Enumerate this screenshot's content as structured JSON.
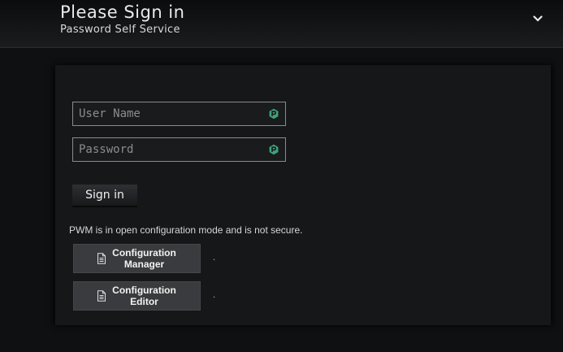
{
  "header": {
    "title": "Please Sign in",
    "subtitle": "Password Self Service",
    "menu_icon": "chevron-down-icon"
  },
  "login": {
    "username_placeholder": "User Name",
    "username_value": "",
    "password_placeholder": "Password",
    "password_value": "",
    "field_icon": "password-manager-icon",
    "signin_label": "Sign in"
  },
  "config": {
    "notice": "PWM is in open configuration mode and is not secure.",
    "manager_label": "Configuration Manager",
    "manager_note": ".",
    "editor_label": "Configuration Editor",
    "editor_note": ".",
    "button_icon": "document-icon"
  },
  "colors": {
    "background": "#0f1012",
    "panel": "#161719",
    "field_icon": "#3fa37a",
    "button": "#3a3b3e"
  }
}
